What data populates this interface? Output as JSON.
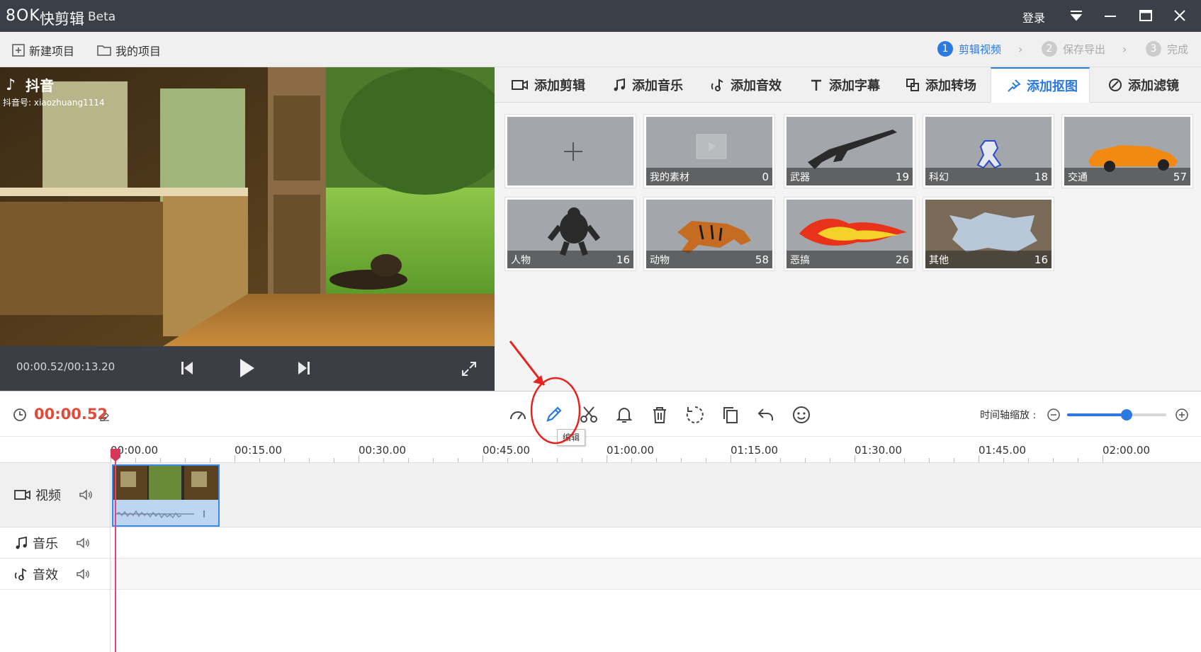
{
  "titlebar": {
    "logo": "8OK",
    "app_name": "快剪辑",
    "beta": "Beta",
    "login": "登录"
  },
  "menu": {
    "new_project": "新建项目",
    "my_projects": "我的项目"
  },
  "steps": [
    {
      "num": "1",
      "label": "剪辑视频"
    },
    {
      "num": "2",
      "label": "保存导出"
    },
    {
      "num": "3",
      "label": "完成"
    }
  ],
  "preview": {
    "watermark_brand": "抖音",
    "watermark_id": "抖音号: xiaozhuang1114",
    "timecode": "00:00.52/00:13.20"
  },
  "tabs": [
    {
      "label": "添加剪辑"
    },
    {
      "label": "添加音乐"
    },
    {
      "label": "添加音效"
    },
    {
      "label": "添加字幕"
    },
    {
      "label": "添加转场"
    },
    {
      "label": "添加抠图"
    },
    {
      "label": "添加滤镜"
    }
  ],
  "active_tab": "添加抠图",
  "materials": [
    {
      "label": "",
      "count": ""
    },
    {
      "label": "我的素材",
      "count": "0"
    },
    {
      "label": "武器",
      "count": "19"
    },
    {
      "label": "科幻",
      "count": "18"
    },
    {
      "label": "交通",
      "count": "57"
    },
    {
      "label": "人物",
      "count": "16"
    },
    {
      "label": "动物",
      "count": "58"
    },
    {
      "label": "恶搞",
      "count": "26"
    },
    {
      "label": "其他",
      "count": "16"
    }
  ],
  "toolbar": {
    "current_time": "00:00.52",
    "tooltip": "编辑",
    "zoom_label": "时间轴缩放 :",
    "zoom_level": 0.6
  },
  "ruler": [
    "00:00.00",
    "00:15.00",
    "00:30.00",
    "00:45.00",
    "01:00.00",
    "01:15.00",
    "01:30.00",
    "01:45.00",
    "02:00.00"
  ],
  "tracks": {
    "video": "视频",
    "music": "音乐",
    "sfx": "音效"
  },
  "colors": {
    "accent": "#2a7ae2",
    "time_red": "#e24a3b",
    "titlebar": "#3a3f48",
    "annotation_red": "#e8231e"
  }
}
